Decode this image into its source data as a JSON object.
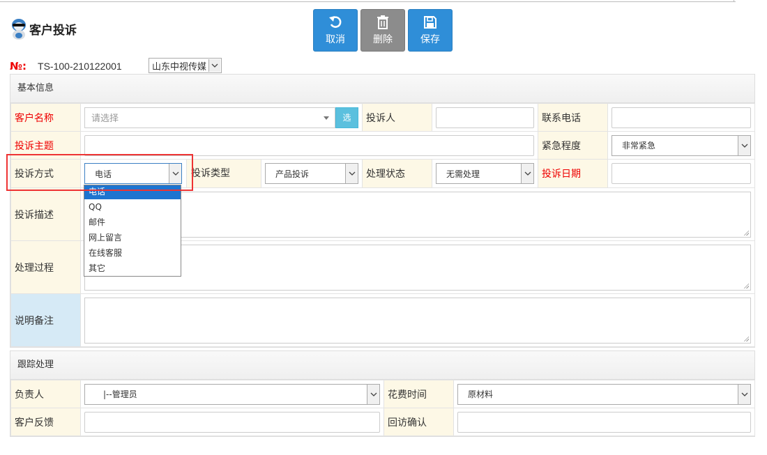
{
  "page": {
    "title": "客户投诉"
  },
  "toolbar": {
    "cancel_label": "取消",
    "delete_label": "删除",
    "save_label": "保存"
  },
  "record": {
    "no_label": "№:",
    "no_value": "TS-100-210122001",
    "company": "山东中视传媒"
  },
  "basic": {
    "header": "基本信息",
    "customer_name_label": "客户名称",
    "customer_placeholder": "请选择",
    "pick_button": "选",
    "complainant_label": "投诉人",
    "phone_label": "联系电话",
    "subject_label": "投诉主题",
    "urgency_label": "紧急程度",
    "urgency_value": "非常紧急",
    "method_label": "投诉方式",
    "method_value": "电话",
    "method_options": [
      "电话",
      "QQ",
      "邮件",
      "网上留言",
      "在线客服",
      "其它"
    ],
    "type_label": "投诉类型",
    "type_value": "产品投诉",
    "status_label": "处理状态",
    "status_value": "无需处理",
    "date_label": "投诉日期",
    "description_label": "投诉描述",
    "process_label": "处理过程",
    "remarks_label": "说明备注"
  },
  "followup": {
    "header": "跟踪处理",
    "owner_label": "负责人",
    "owner_value": "|--管理员",
    "time_label": "花费时间",
    "time_value": "原材料",
    "feedback_label": "客户反馈",
    "revisit_label": "回访确认"
  },
  "colors": {
    "primary": "#2f8ed8",
    "danger_text": "#ee0000",
    "label_bg": "#fdf8e6",
    "highlight": "#ee3333"
  }
}
